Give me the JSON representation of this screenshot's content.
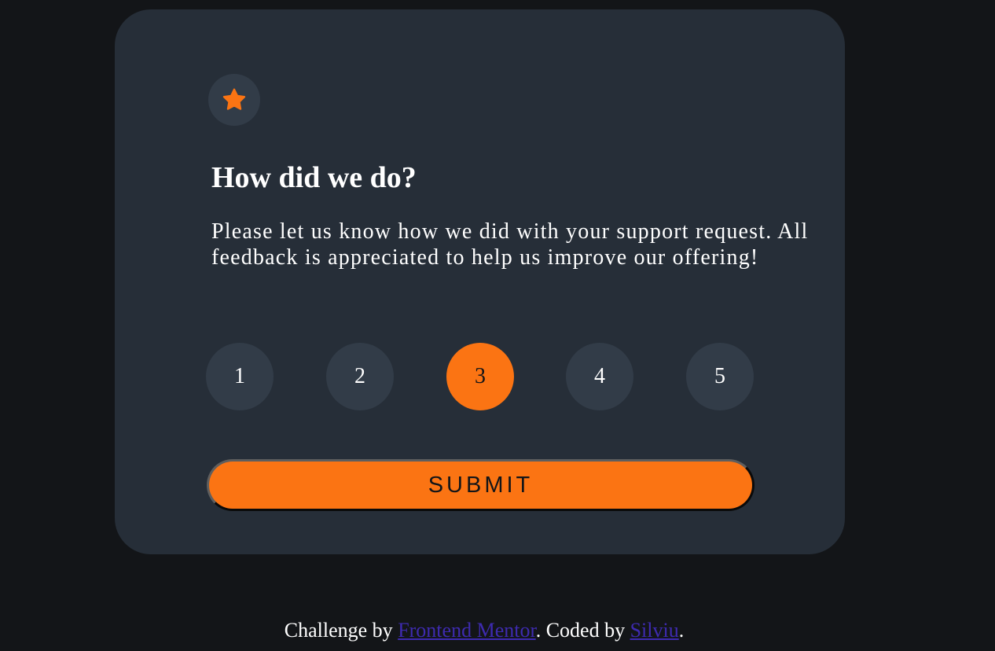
{
  "card": {
    "icon": "star-icon",
    "title": "How did we do?",
    "description": "Please let us know how we did with your support request. All feedback is appreciated to help us improve our offering!",
    "ratings": [
      {
        "label": "1",
        "selected": false
      },
      {
        "label": "2",
        "selected": false
      },
      {
        "label": "3",
        "selected": true
      },
      {
        "label": "4",
        "selected": false
      },
      {
        "label": "5",
        "selected": false
      }
    ],
    "submit_label": "SUBMIT"
  },
  "footer": {
    "prefix": "Challenge by ",
    "link1": "Frontend Mentor",
    "middle": ". Coded by ",
    "link2": "Silviu",
    "suffix": "."
  },
  "colors": {
    "page_bg": "#131518",
    "card_bg": "#262e38",
    "circle_bg": "#323c48",
    "accent": "#fb7413",
    "link": "#3e2bb0"
  }
}
